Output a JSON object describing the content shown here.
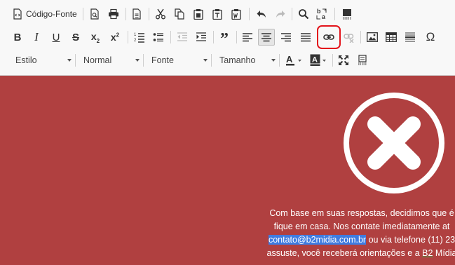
{
  "toolbar": {
    "source_label": "Código-Fonte",
    "style_combo": "Estilo",
    "format_combo": "Normal",
    "font_combo": "Fonte",
    "size_combo": "Tamanho",
    "highlighted_button": "link",
    "icons": {
      "row1": [
        "source-icon",
        "preview-icon",
        "print-icon",
        "templates-icon",
        "cut-icon",
        "copy-icon",
        "paste-icon",
        "paste-text-icon",
        "paste-word-icon",
        "undo-icon",
        "redo-icon",
        "find-icon",
        "replace-icon",
        "select-all-icon"
      ],
      "row2": [
        "bold-icon",
        "italic-icon",
        "underline-icon",
        "strikethrough-icon",
        "subscript-icon",
        "superscript-icon",
        "numbered-list-icon",
        "bulleted-list-icon",
        "outdent-icon",
        "indent-icon",
        "blockquote-icon",
        "align-left-icon",
        "align-center-icon",
        "align-right-icon",
        "justify-icon",
        "link-icon",
        "unlink-icon",
        "image-icon",
        "table-icon",
        "horizontal-line-icon",
        "special-char-icon"
      ],
      "row3": [
        "text-color-icon",
        "background-color-icon",
        "maximize-icon",
        "show-blocks-icon"
      ]
    }
  },
  "content": {
    "line1": "Com base em suas respostas, decidimos que é",
    "line2": "fique em casa. Nos contate imediatamente at",
    "email": "contato@b2midia.com.br",
    "line3_rest": " ou via telefone (11) 23",
    "line4_a": "assuste, você receberá orientações e a ",
    "line4_b": "B2",
    "line4_c": " Mídia",
    "background_color": "#b04040",
    "selection_color": "#3f7be0"
  }
}
